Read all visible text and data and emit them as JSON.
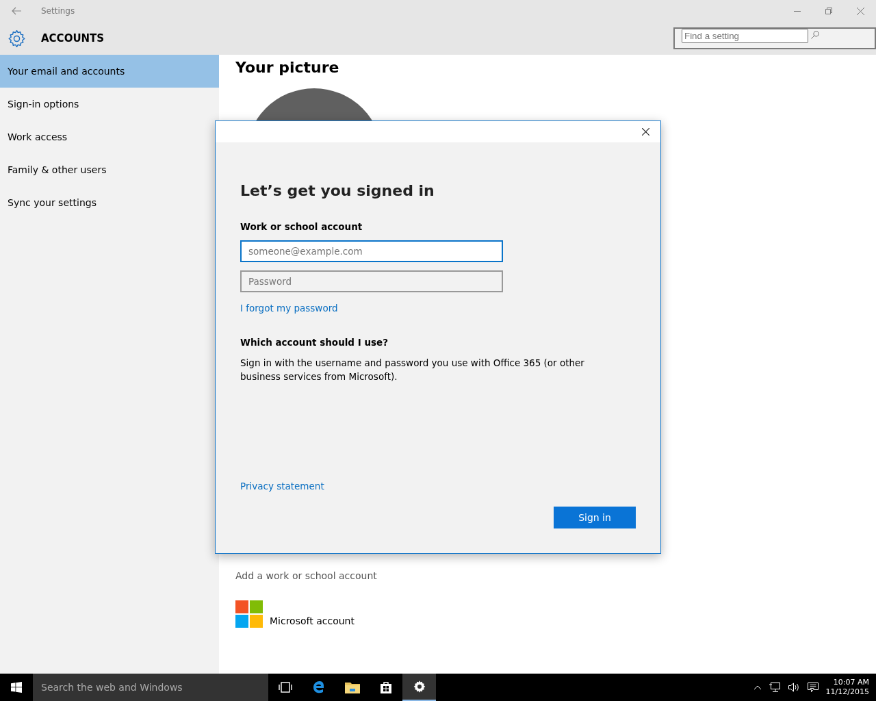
{
  "window": {
    "title": "Settings"
  },
  "header": {
    "title": "ACCOUNTS",
    "search": {
      "placeholder": "Find a setting"
    }
  },
  "sidebar": {
    "items": [
      {
        "label": "Your email and accounts",
        "selected": true
      },
      {
        "label": "Sign-in options",
        "selected": false
      },
      {
        "label": "Work access",
        "selected": false
      },
      {
        "label": "Family & other users",
        "selected": false
      },
      {
        "label": "Sync your settings",
        "selected": false
      }
    ]
  },
  "content": {
    "heading": "Your picture",
    "add_account": "Add a work or school account",
    "microsoft_account": "Microsoft account"
  },
  "dialog": {
    "title": "Let’s get you signed in",
    "account_label": "Work or school account",
    "email": {
      "placeholder": "someone@example.com"
    },
    "password": {
      "placeholder": "Password"
    },
    "forgot_link": "I forgot my password",
    "help_heading": "Which account should I use?",
    "help_text": "Sign in with the username and password you use with Office 365 (or other business services from Microsoft).",
    "privacy_link": "Privacy statement",
    "sign_in_button": "Sign in"
  },
  "taskbar": {
    "search": {
      "placeholder": "Search the web and Windows"
    },
    "time": "10:07 AM",
    "date": "11/12/2015"
  }
}
